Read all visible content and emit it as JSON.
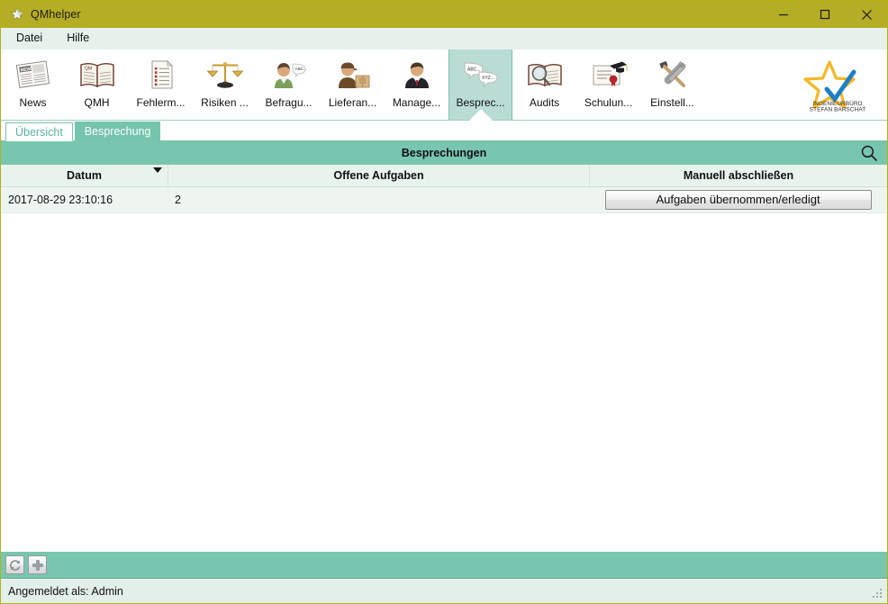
{
  "window": {
    "title": "QMhelper",
    "icon": "star-icon",
    "controls": {
      "minimize": "minimize-icon",
      "maximize": "maximize-icon",
      "close": "close-icon"
    }
  },
  "menubar": {
    "items": [
      {
        "label": "Datei",
        "name": "menu-datei"
      },
      {
        "label": "Hilfe",
        "name": "menu-hilfe"
      }
    ]
  },
  "toolbar": {
    "items": [
      {
        "label": "News",
        "icon": "newspaper-icon",
        "name": "toolbar-item-news",
        "active": false
      },
      {
        "label": "QMH",
        "icon": "open-book-icon",
        "name": "toolbar-item-qmh",
        "active": false
      },
      {
        "label": "Fehlerm...",
        "icon": "checklist-icon",
        "name": "toolbar-item-fehlermeldung",
        "active": false
      },
      {
        "label": "Risiken ...",
        "icon": "scales-icon",
        "name": "toolbar-item-risiken",
        "active": false
      },
      {
        "label": "Befragu...",
        "icon": "person-speech-icon",
        "name": "toolbar-item-befragung",
        "active": false
      },
      {
        "label": "Lieferan...",
        "icon": "delivery-icon",
        "name": "toolbar-item-lieferanten",
        "active": false
      },
      {
        "label": "Manage...",
        "icon": "manager-icon",
        "name": "toolbar-item-management",
        "active": false
      },
      {
        "label": "Besprec...",
        "icon": "speech-bubbles-icon",
        "name": "toolbar-item-besprechung",
        "active": true
      },
      {
        "label": "Audits",
        "icon": "book-magnifier-icon",
        "name": "toolbar-item-audits",
        "active": false
      },
      {
        "label": "Schulun...",
        "icon": "certificate-icon",
        "name": "toolbar-item-schulungen",
        "active": false
      },
      {
        "label": "Einstell...",
        "icon": "tools-icon",
        "name": "toolbar-item-einstellungen",
        "active": false
      }
    ],
    "logo": {
      "icon": "star-check-logo",
      "line1": "INGENIEURBÜRO",
      "line2": "STEFAN BARSCHAT"
    }
  },
  "tabs": [
    {
      "label": "Übersicht",
      "name": "tab-uebersicht",
      "active": true
    },
    {
      "label": "Besprechung",
      "name": "tab-besprechung",
      "active": false
    }
  ],
  "panel": {
    "title": "Besprechungen",
    "search_icon": "search-icon",
    "columns": [
      {
        "label": "Datum",
        "name": "column-header-datum",
        "sorted": true
      },
      {
        "label": "Offene Aufgaben",
        "name": "column-header-offene-aufgaben",
        "sorted": false
      },
      {
        "label": "Manuell abschließen",
        "name": "column-header-manuell-abschliessen",
        "sorted": false
      }
    ],
    "rows": [
      {
        "datum": "2017-08-29 23:10:16",
        "offene_aufgaben": "2",
        "action_label": "Aufgaben übernommen/erledigt"
      }
    ]
  },
  "actionbar": {
    "buttons": [
      {
        "icon": "refresh-icon",
        "name": "refresh-button"
      },
      {
        "icon": "plus-icon",
        "name": "add-button"
      }
    ]
  },
  "statusbar": {
    "text": "Angemeldet als: Admin",
    "grip": "resize-grip"
  },
  "colors": {
    "titlebar": "#b5ad25",
    "teal": "#79c6af",
    "teal_light": "#b9ddd3",
    "panel_bg": "#e9f3ee",
    "row_bg": "#eef5f1",
    "logo_star": "#f5b824",
    "logo_check": "#1f7fc4"
  }
}
